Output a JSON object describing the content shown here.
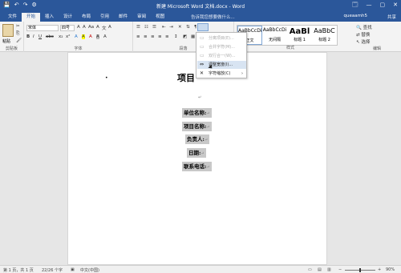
{
  "titlebar": {
    "title": "新建 Microsoft Word 文档.docx - Word",
    "qat": [
      "💾",
      "↶",
      "↷",
      "⚙"
    ],
    "window_controls": [
      "🗔",
      "—",
      "▢",
      "✕"
    ]
  },
  "tabs": [
    "文件",
    "开始",
    "插入",
    "设计",
    "布局",
    "引用",
    "邮件",
    "审阅",
    "视图"
  ],
  "active_tab": "开始",
  "tell_me": "告诉我您想要做什么...",
  "user": "queaamh5",
  "share": "共享",
  "ribbon": {
    "clipboard": {
      "paste": "粘贴",
      "label": "剪贴板"
    },
    "font": {
      "name": "宋体",
      "size": "四号",
      "label": "字体",
      "row1_tools": [
        "A",
        "A",
        "Aa",
        "A",
        "文",
        "A"
      ],
      "row2_tools": [
        "B",
        "I",
        "U",
        "abc",
        "x₂",
        "x²",
        "A",
        "A",
        "A",
        "A",
        "A"
      ]
    },
    "paragraph": {
      "label": "段落"
    },
    "styles": {
      "label": "样式",
      "items": [
        {
          "preview": "AaBbCcDi",
          "name": "正文"
        },
        {
          "preview": "AaBbCcDi",
          "name": "无间隔"
        },
        {
          "preview": "AaBl",
          "name": "标题 1"
        },
        {
          "preview": "AaBbC",
          "name": "标题 2"
        }
      ]
    },
    "editing": {
      "label": "编辑",
      "find": "查找",
      "replace": "替换",
      "select": "选择"
    }
  },
  "menu": {
    "items": [
      {
        "label": "分离项目(E)...",
        "enabled": false
      },
      {
        "label": "合并字符(M)...",
        "enabled": false
      },
      {
        "label": "双行合一(W)...",
        "enabled": false
      },
      {
        "label": "调整宽度(I)...",
        "enabled": true,
        "highlighted": true
      },
      {
        "label": "字符缩放(C)",
        "enabled": true
      }
    ]
  },
  "document": {
    "heading": "项目",
    "fields": [
      "单位名称:",
      "项目名称:",
      "负责人:",
      "日期:",
      "联系电话:"
    ]
  },
  "status": {
    "page": "第 1 页，共 1 页",
    "words": "22/26 个字",
    "lang": "中文(中国)",
    "zoom": "90%"
  }
}
